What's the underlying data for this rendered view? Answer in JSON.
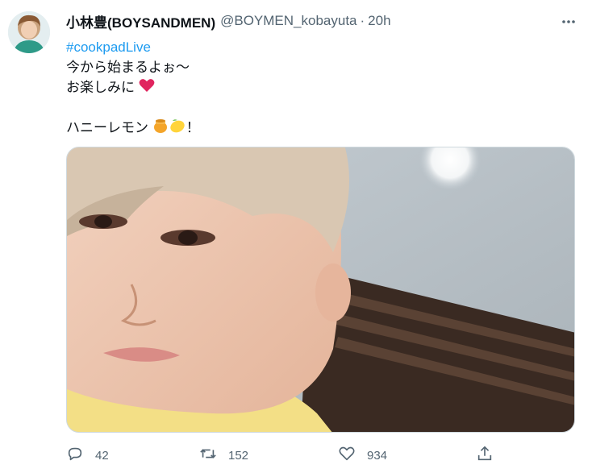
{
  "tweet": {
    "display_name": "小林豊(BOYSANDMEN)",
    "handle": "@BOYMEN_kobayuta",
    "separator": "·",
    "time": "20h",
    "hashtag": "#cookpadLive",
    "line2": "今から始まるよぉ～",
    "line3": "お楽しみに",
    "line5": "ハニーレモン",
    "line5_end": "！"
  },
  "actions": {
    "reply_count": "42",
    "retweet_count": "152",
    "like_count": "934"
  },
  "icons": [
    "more-icon",
    "heart-emoji",
    "honey-emoji",
    "lemon-emoji",
    "reply-icon",
    "retweet-icon",
    "like-icon",
    "share-icon"
  ],
  "colors": {
    "link": "#1d9bf0",
    "secondary_text": "#536471",
    "heart": "#e0245e"
  }
}
